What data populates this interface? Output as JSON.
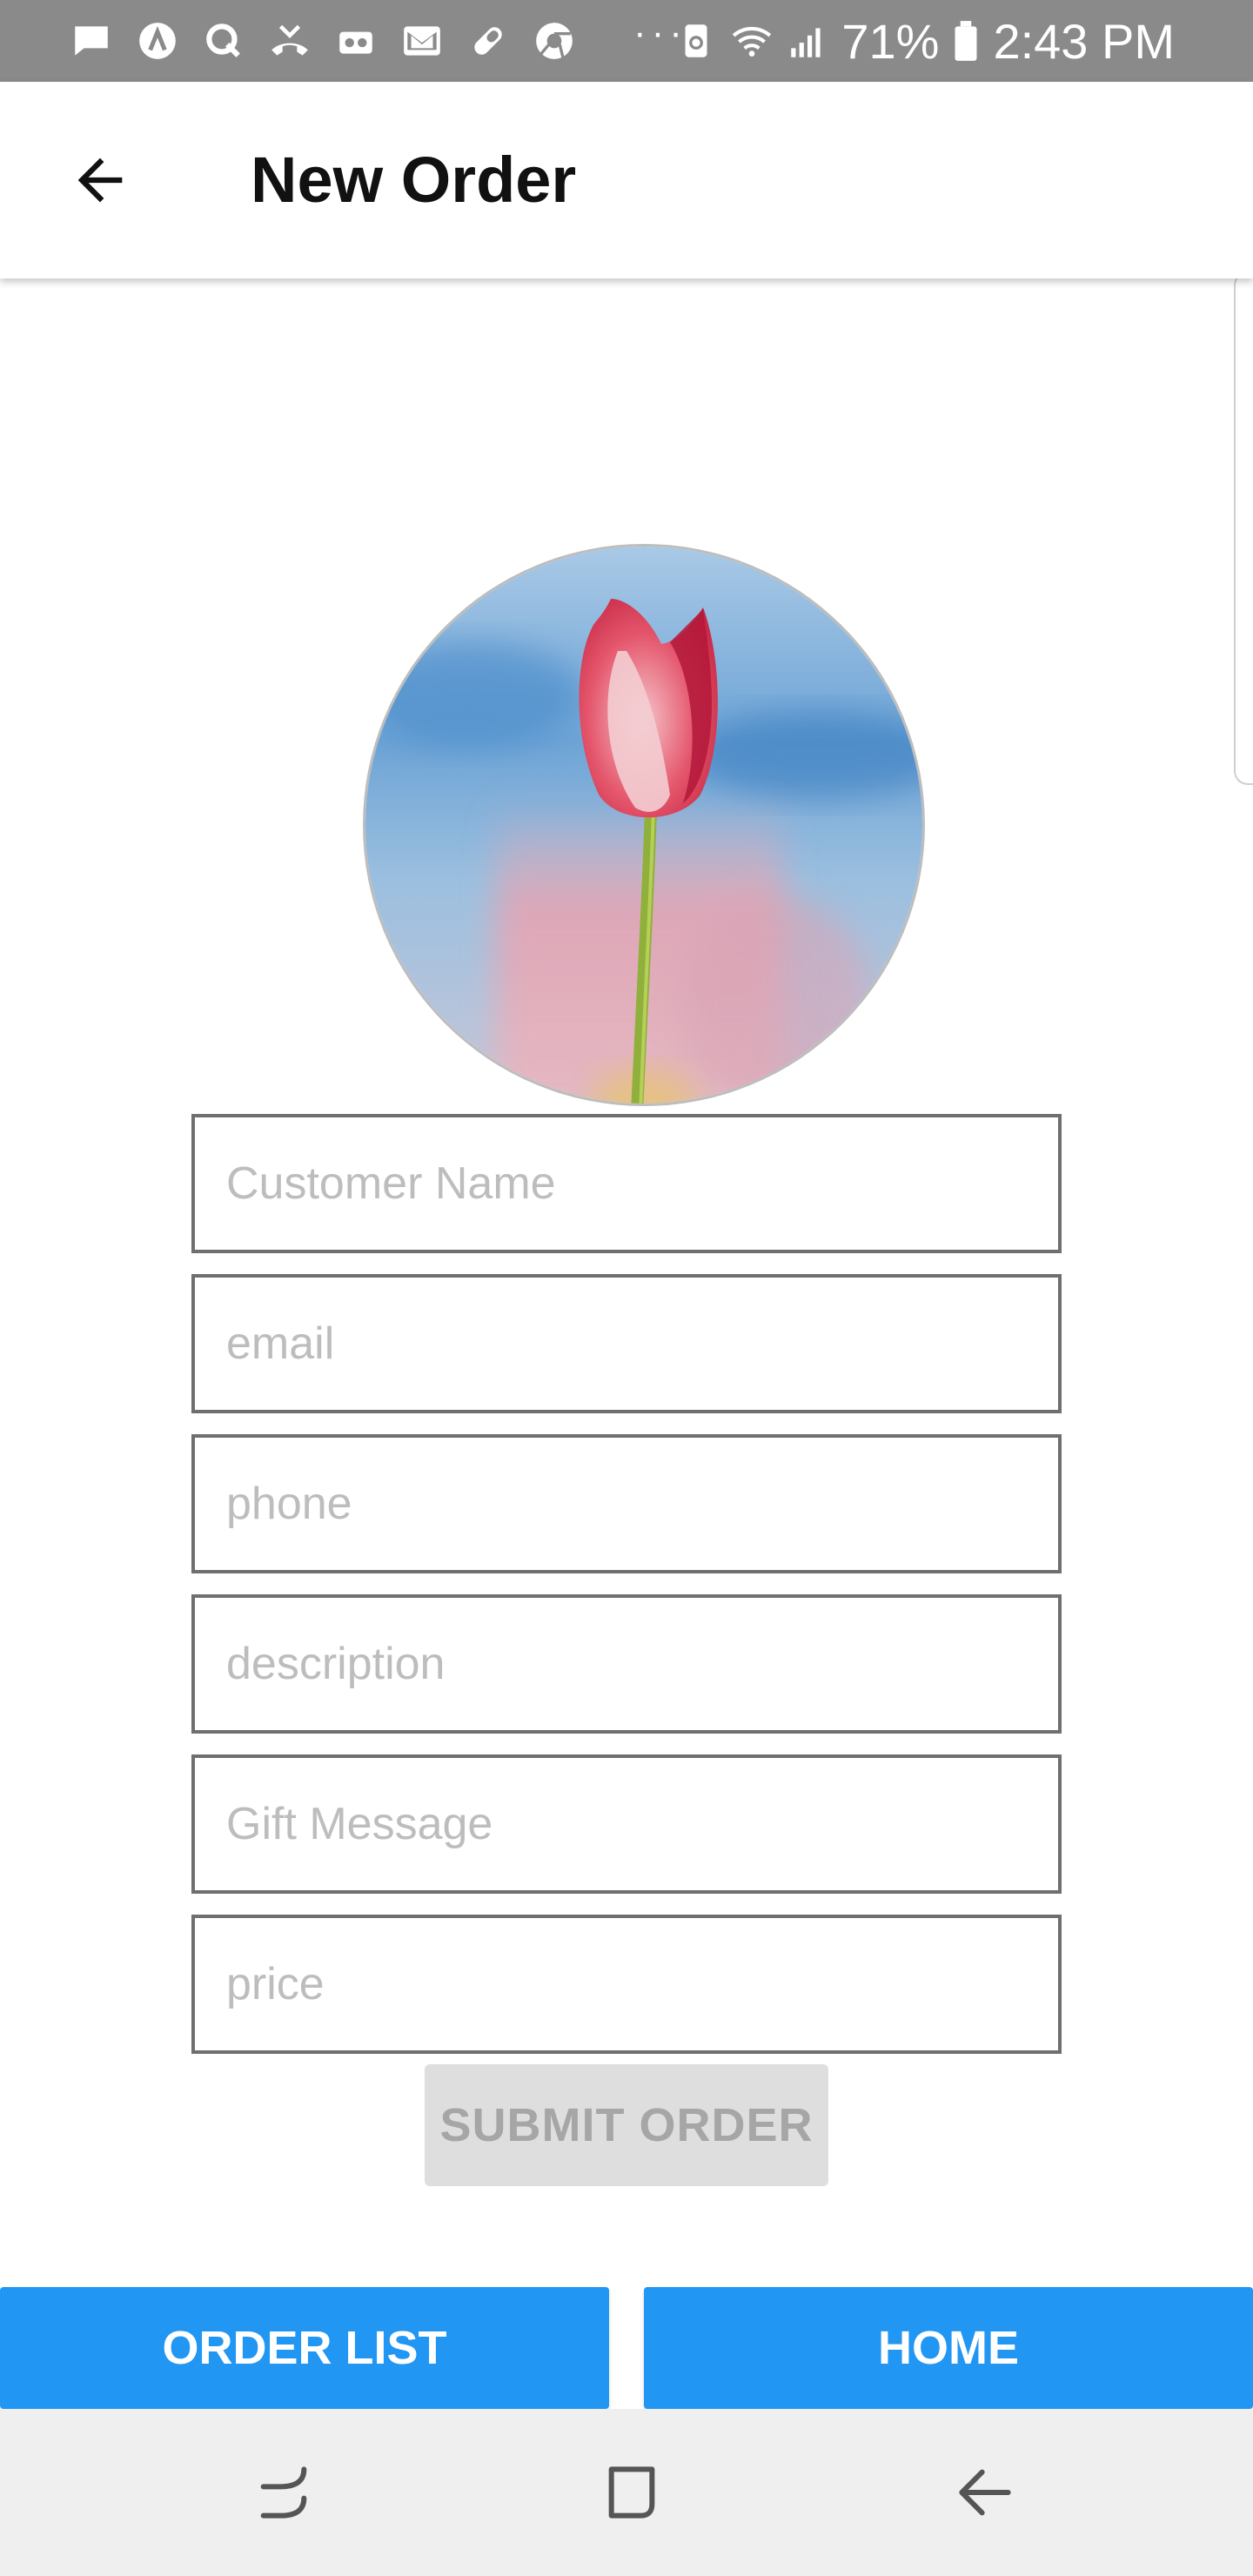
{
  "status_bar": {
    "notification_icons": [
      "message-icon",
      "app-lambda-icon",
      "app-q-icon",
      "missed-call-icon",
      "voicemail-icon",
      "gmail-icon",
      "pill-icon",
      "chrome-icon"
    ],
    "more_indicator": "···",
    "battery_percent": "71%",
    "time": "2:43 PM"
  },
  "app_bar": {
    "title": "New Order"
  },
  "form": {
    "customer_name_placeholder": "Customer Name",
    "email_placeholder": "email",
    "phone_placeholder": "phone",
    "description_placeholder": "description",
    "gift_message_placeholder": "Gift Message",
    "price_placeholder": "price",
    "submit_label": "SUBMIT ORDER"
  },
  "bottom_actions": {
    "order_list_label": "ORDER LIST",
    "home_label": "HOME"
  },
  "colors": {
    "status_bar": "#8a8a8a",
    "primary_button": "#2196f3",
    "disabled_button": "#dedede",
    "field_border": "#6f6f6f",
    "nav_bar": "#efefef"
  },
  "photo": {
    "subject": "red-tulip-photo"
  }
}
